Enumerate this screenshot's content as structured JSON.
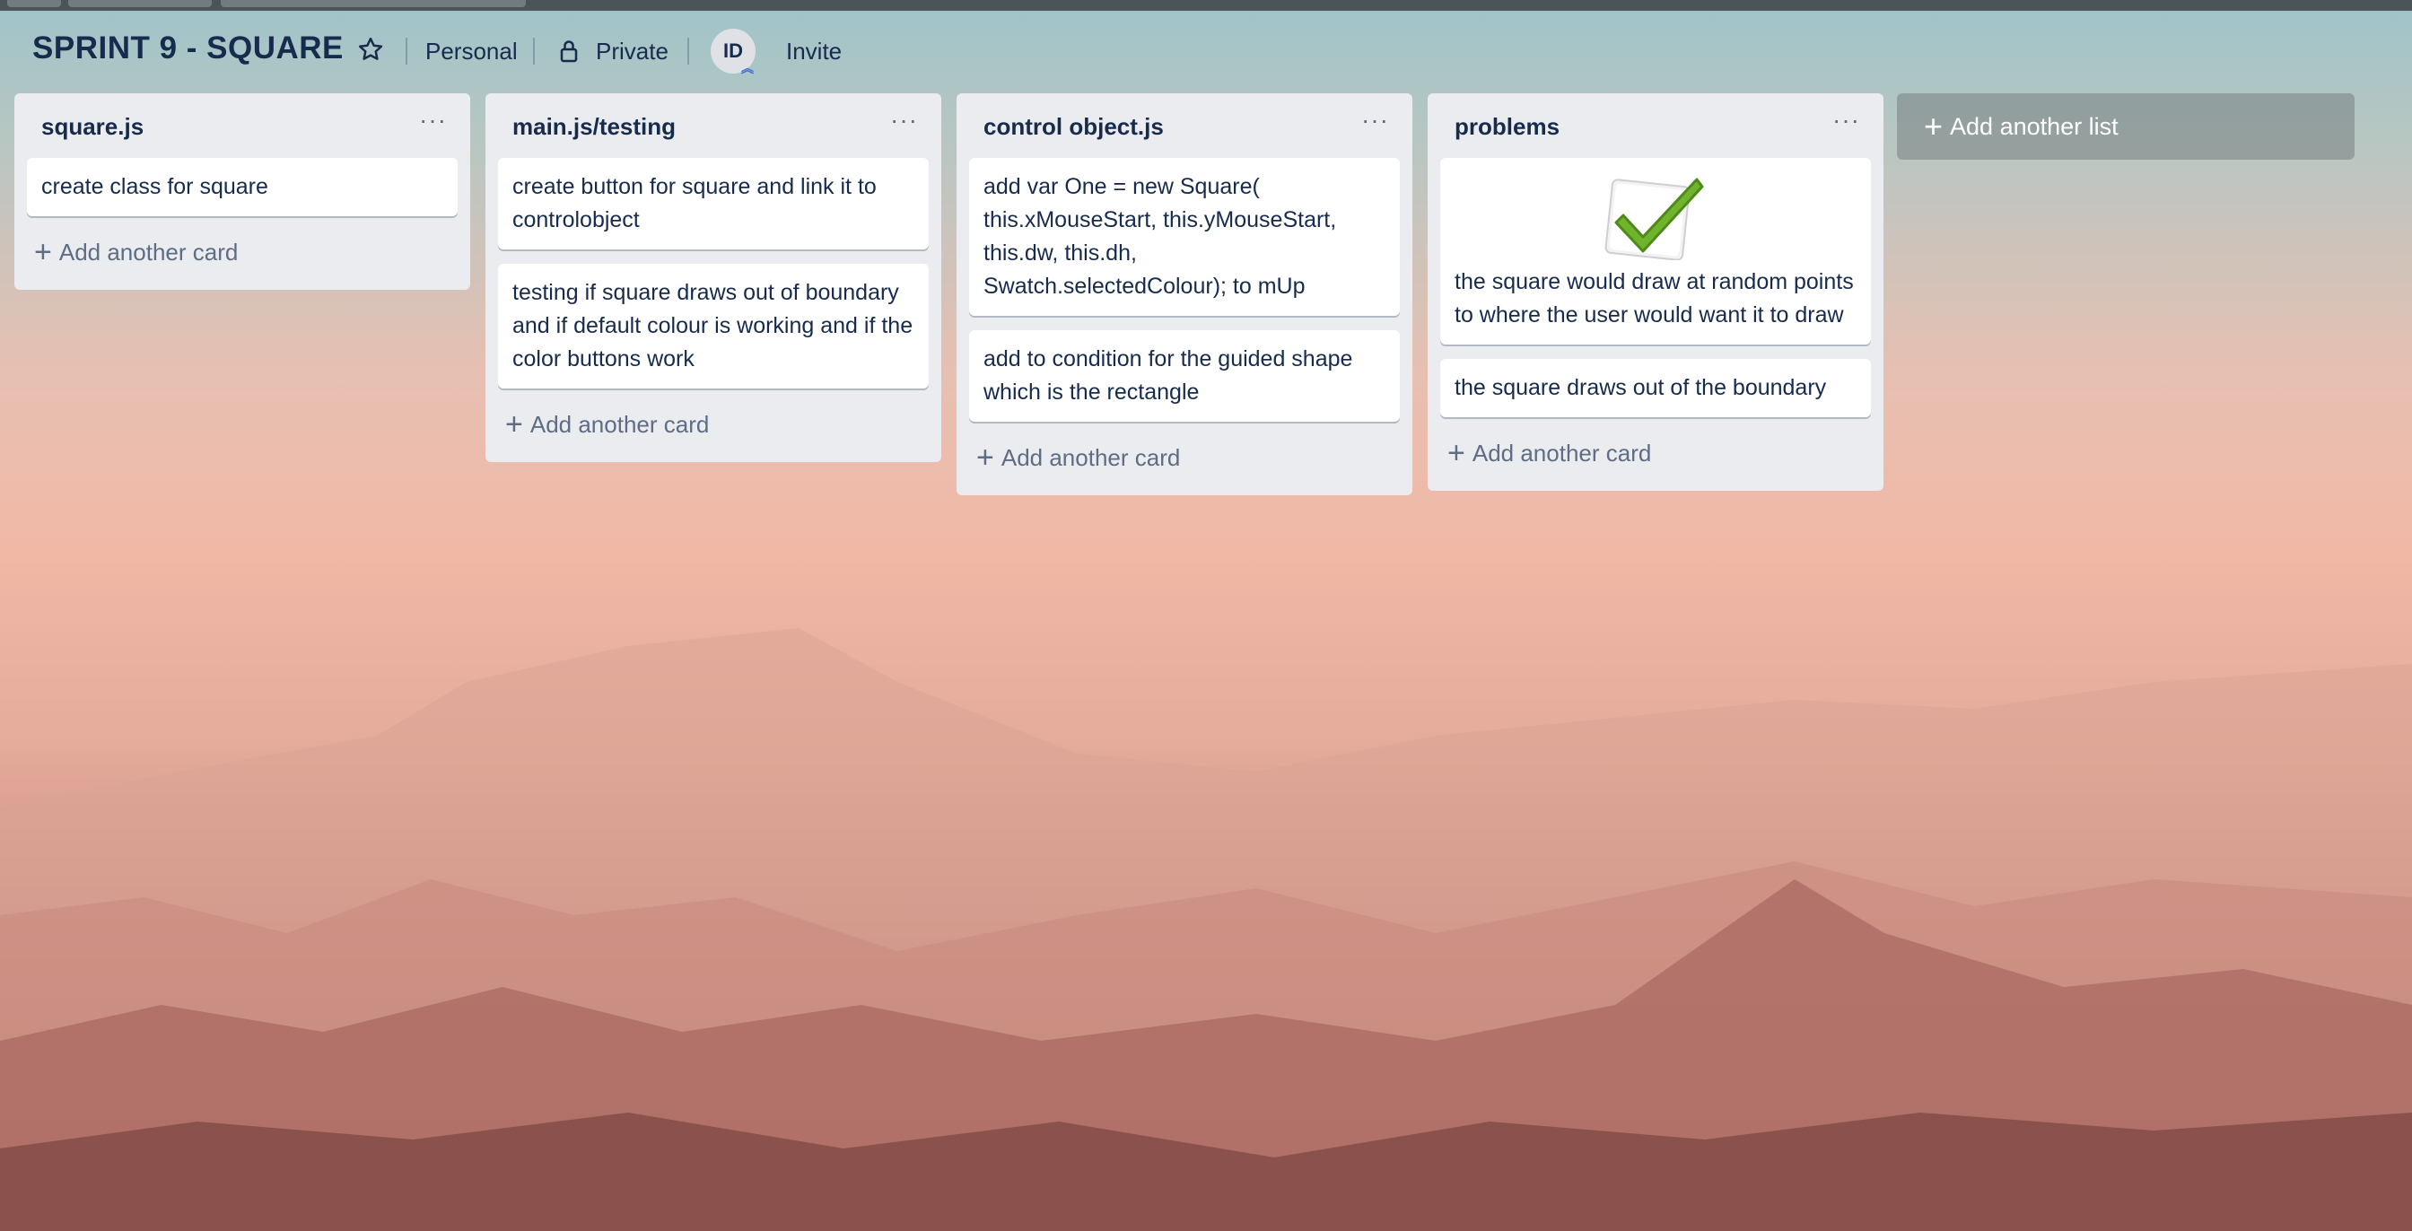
{
  "board": {
    "title": "SPRINT 9 - SQUARE",
    "workspace": "Personal",
    "visibility": "Private",
    "member_initials": "ID",
    "invite_label": "Invite"
  },
  "icons": {
    "star": "star-icon",
    "lock": "lock-icon",
    "menu": "more-horizontal-icon",
    "plus": "plus-icon",
    "checkmark": "green-checkmark-image"
  },
  "colors": {
    "list_bg": "#ebecf0",
    "text": "#172b4d",
    "muted": "#5e6c84",
    "check_green": "#6fb42c"
  },
  "lists": [
    {
      "title": "square.js",
      "cards": [
        "create class for square"
      ],
      "add_card_label": "Add another card"
    },
    {
      "title": "main.js/testing",
      "cards": [
        "create button for square and link it to controlobject",
        "testing if square draws out of boundary and if default colour is working and if the color buttons work"
      ],
      "add_card_label": "Add another card"
    },
    {
      "title": "control object.js",
      "cards": [
        "add var One = new Square( this.xMouseStart, this.yMouseStart, this.dw, this.dh, Swatch.selectedColour); to mUp",
        "add to condition for the guided shape which is the rectangle"
      ],
      "add_card_label": "Add another card"
    },
    {
      "title": "problems",
      "cards": [
        "the square would draw at random points to where the user would want it to draw",
        "the square draws out of the boundary"
      ],
      "add_card_label": "Add another card"
    }
  ],
  "add_list_label": "Add another list"
}
